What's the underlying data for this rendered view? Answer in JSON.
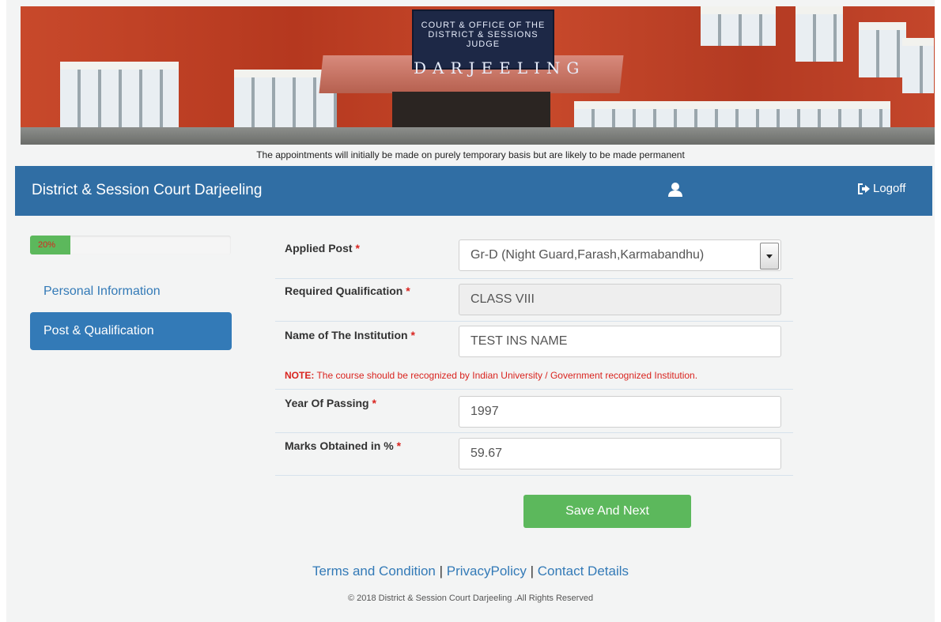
{
  "banner": {
    "sign_line1": "COURT & OFFICE OF THE DISTRICT & SESSIONS JUDGE",
    "sign_line2": "DARJEELING"
  },
  "marquee_text": "The appointments will initially be made on purely temporary basis but are likely to be made permanent",
  "navbar": {
    "brand": "District & Session Court Darjeeling",
    "logoff_label": "Logoff"
  },
  "progress": {
    "label": "20%",
    "value": 0.2
  },
  "sidebar": {
    "items": [
      {
        "label": "Personal Information"
      },
      {
        "label": "Post & Qualification"
      }
    ]
  },
  "form": {
    "applied_post": {
      "label": "Applied Post",
      "value": "Gr-D (Night Guard,Farash,Karmabandhu)"
    },
    "required_qualification": {
      "label": "Required Qualification",
      "value": "CLASS VIII"
    },
    "institution": {
      "label": "Name of The Institution",
      "value": "TEST INS NAME"
    },
    "note_prefix": "NOTE:",
    "note_text": " The course should be recognized by Indian University / Government recognized Institution.",
    "year_of_passing": {
      "label": "Year Of Passing",
      "value": "1997"
    },
    "marks": {
      "label": "Marks Obtained in %",
      "value": "59.67"
    },
    "required_marker": "*",
    "save_label": "Save And Next"
  },
  "footer": {
    "terms": "Terms and Condition",
    "privacy": "PrivacyPolicy",
    "contact": "Contact Details",
    "separator": " | ",
    "copyright": "© 2018 District & Session Court Darjeeling .All Rights Reserved"
  },
  "colors": {
    "navbar": "#306ea4",
    "accent": "#337ab7",
    "success": "#5cb85c",
    "required": "#d9241f"
  }
}
